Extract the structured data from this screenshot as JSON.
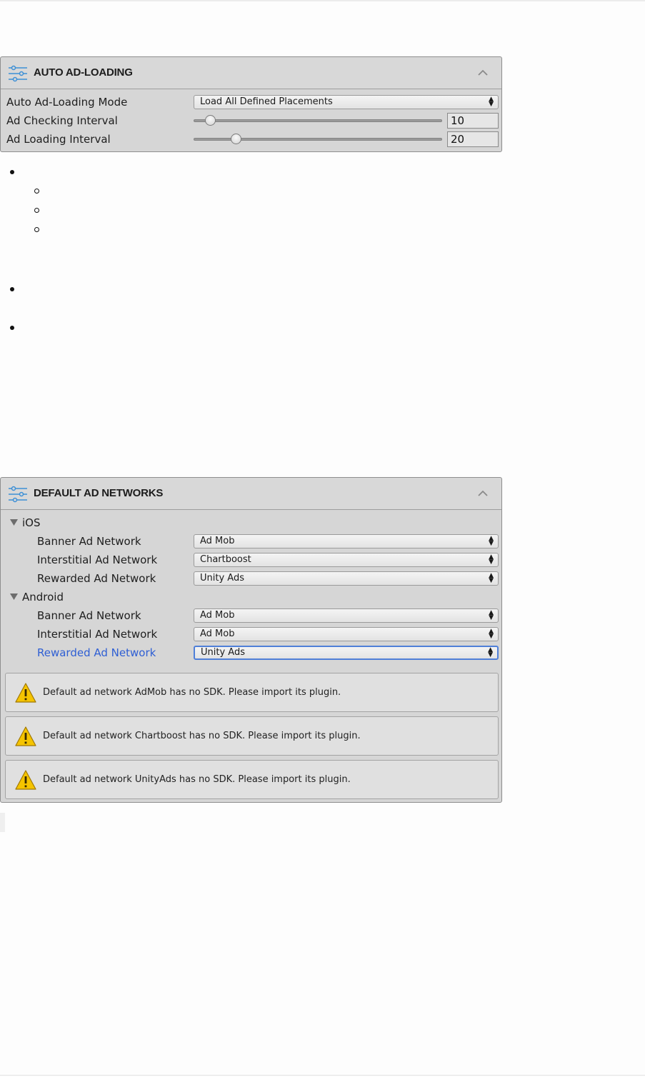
{
  "auto_ad_loading": {
    "title": "AUTO AD-LOADING",
    "icon": "sliders-icon",
    "mode_label": "Auto Ad-Loading Mode",
    "mode_value": "Load All Defined Placements",
    "checking_label": "Ad Checking Interval",
    "checking_value": "10",
    "loading_label": "Ad Loading Interval",
    "loading_value": "20"
  },
  "default_ad_networks": {
    "title": "DEFAULT AD NETWORKS",
    "icon": "sliders-icon",
    "ios": {
      "label": "iOS",
      "banner_label": "Banner Ad Network",
      "banner_value": "Ad Mob",
      "interstitial_label": "Interstitial Ad Network",
      "interstitial_value": "Chartboost",
      "rewarded_label": "Rewarded Ad Network",
      "rewarded_value": "Unity Ads"
    },
    "android": {
      "label": "Android",
      "banner_label": "Banner Ad Network",
      "banner_value": "Ad Mob",
      "interstitial_label": "Interstitial Ad Network",
      "interstitial_value": "Ad Mob",
      "rewarded_label": "Rewarded Ad Network",
      "rewarded_value": "Unity Ads"
    },
    "warnings": [
      "Default ad network AdMob has no SDK. Please import its plugin.",
      "Default ad network Chartboost has no SDK. Please import its plugin.",
      "Default ad network UnityAds has no SDK. Please import its plugin."
    ]
  },
  "colors": {
    "panel_bg": "#d6d6d6",
    "accent_blue": "#2f5fd4",
    "icon_blue": "#3c8fd6",
    "warning_yellow": "#f5c400"
  }
}
